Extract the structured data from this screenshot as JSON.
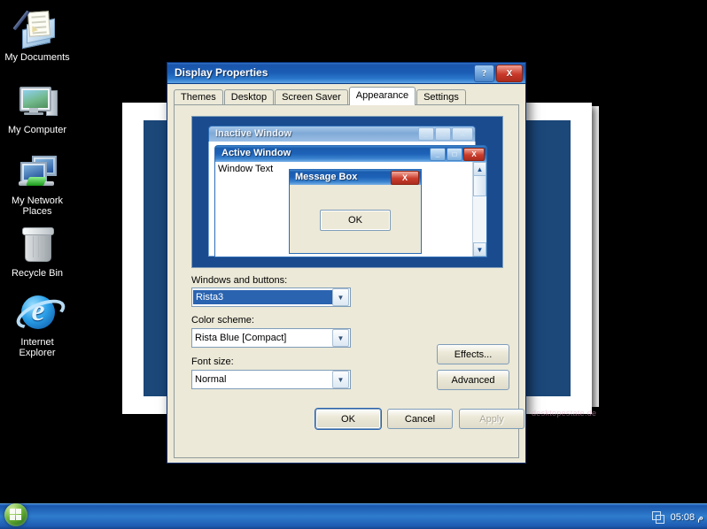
{
  "desktop": {
    "icons": [
      {
        "label": "My Documents",
        "icon": "my-documents-icon"
      },
      {
        "label": "My Computer",
        "icon": "my-computer-icon"
      },
      {
        "label": "My Network\nPlaces",
        "label_line1": "My Network",
        "label_line2": "Places",
        "icon": "my-network-places-icon"
      },
      {
        "label": "Recycle Bin",
        "icon": "recycle-bin-icon"
      },
      {
        "label": "Internet\nExplorer",
        "label_line1": "Internet",
        "label_line2": "Explorer",
        "icon": "internet-explorer-icon"
      }
    ]
  },
  "dialog": {
    "title": "Display Properties",
    "help_button": "?",
    "close_button": "X",
    "tabs": [
      {
        "label": "Themes",
        "active": false
      },
      {
        "label": "Desktop",
        "active": false
      },
      {
        "label": "Screen Saver",
        "active": false
      },
      {
        "label": "Appearance",
        "active": true
      },
      {
        "label": "Settings",
        "active": false
      }
    ],
    "preview": {
      "inactive_window": {
        "title": "Inactive Window",
        "minimize": "_",
        "maximize": "□",
        "close": "X"
      },
      "active_window": {
        "title": "Active Window",
        "body_text": "Window Text",
        "minimize": "_",
        "maximize": "□",
        "close": "X",
        "scroll_up": "▲",
        "scroll_down": "▼"
      },
      "message_box": {
        "title": "Message Box",
        "close": "X",
        "ok_button": "OK"
      }
    },
    "fields": {
      "windows_and_buttons": {
        "label": "Windows and buttons:",
        "value": "Rista3",
        "arrow": "▼"
      },
      "color_scheme": {
        "label": "Color scheme:",
        "value": "Rista Blue [Compact]",
        "arrow": "▼"
      },
      "font_size": {
        "label": "Font size:",
        "value": "Normal",
        "arrow": "▼"
      }
    },
    "side_buttons": {
      "effects": "Effects...",
      "advanced": "Advanced"
    },
    "footer_buttons": {
      "ok": "OK",
      "cancel": "Cancel",
      "apply": "Apply"
    },
    "watermark": "desktopestate.de"
  },
  "taskbar": {
    "start_button": "start-orb",
    "tray_icon": "network-icon",
    "clock": "05:08 م"
  },
  "colors": {
    "desktop_bg": "#000000",
    "titlebar_blue": "#1b5cb5",
    "close_red": "#c9392a",
    "dialog_face": "#ece9d8",
    "preview_bg": "#1a4b8f",
    "selection_blue": "#2a63b0",
    "bgwindow_inner": "#1b4779"
  }
}
